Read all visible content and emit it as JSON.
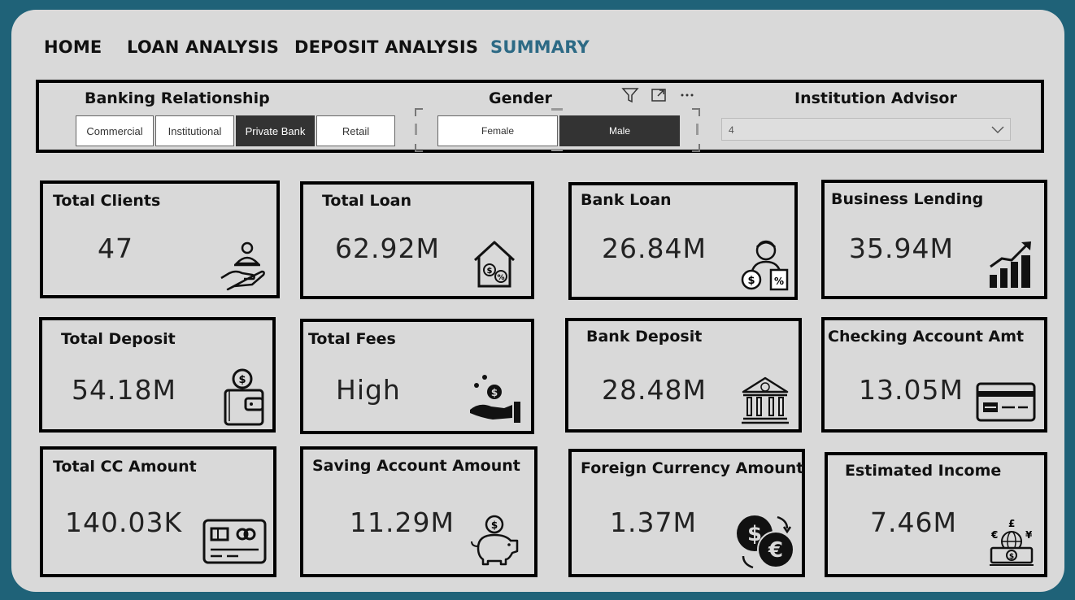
{
  "nav": {
    "home": "HOME",
    "loan_analysis": "LOAN ANALYSIS",
    "deposit_analysis": "DEPOSIT ANALYSIS",
    "summary": "SUMMARY",
    "active_color": "#2d6a85"
  },
  "filters": {
    "banking_relationship": {
      "title": "Banking Relationship",
      "options": [
        "Commercial",
        "Institutional",
        "Private Bank",
        "Retail"
      ],
      "selected": "Private Bank"
    },
    "gender": {
      "title": "Gender",
      "options": [
        "Female",
        "Male"
      ],
      "selected": "Male",
      "visual_icons": [
        "filter-icon",
        "focus-mode-icon",
        "more-options-icon"
      ]
    },
    "institution_advisor": {
      "title": "Institution Advisor",
      "value": "4"
    }
  },
  "cards": [
    {
      "title": "Total Clients",
      "value": "47",
      "icon": "hand-user-icon"
    },
    {
      "title": "Total Loan",
      "value": "62.92M",
      "icon": "house-money-icon"
    },
    {
      "title": "Bank Loan",
      "value": "26.84M",
      "icon": "person-money-bags-icon"
    },
    {
      "title": "Business Lending",
      "value": "35.94M",
      "icon": "growth-chart-icon"
    },
    {
      "title": "Total Deposit",
      "value": "54.18M",
      "icon": "wallet-coin-icon"
    },
    {
      "title": "Total Fees",
      "value": "High",
      "icon": "hand-coin-icon"
    },
    {
      "title": "Bank Deposit",
      "value": "28.48M",
      "icon": "bank-building-icon"
    },
    {
      "title": "Checking Account Amt",
      "value": "13.05M",
      "icon": "credit-card-icon"
    },
    {
      "title": "Total CC Amount",
      "value": "140.03K",
      "icon": "card-chip-icon"
    },
    {
      "title": "Saving Account Amount",
      "value": "11.29M",
      "icon": "piggy-bank-icon"
    },
    {
      "title": "Foreign Currency Amount",
      "value": "1.37M",
      "icon": "currency-exchange-icon"
    },
    {
      "title": "Estimated Income",
      "value": "7.46M",
      "icon": "globe-currency-icon"
    }
  ],
  "colors": {
    "background": "#1f6278",
    "panel": "#d9d9d9",
    "selected_chip": "#333333"
  }
}
